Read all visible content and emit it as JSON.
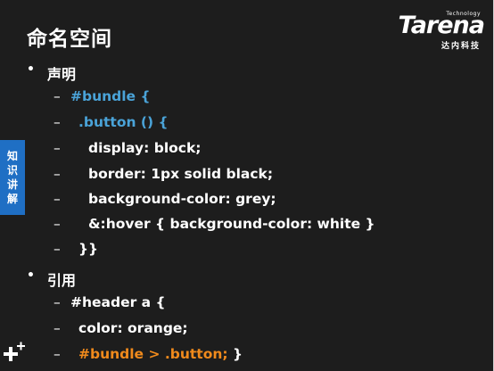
{
  "title": "命名空间",
  "logo": {
    "tech": "Technology",
    "brand": "Tarena",
    "cn": "达内科技"
  },
  "side_tab": [
    "知",
    "识",
    "讲",
    "解"
  ],
  "colors": {
    "background": "#1d1d1d",
    "text": "#ffffff",
    "keyword_blue": "#4aa3d8",
    "highlight_orange": "#f08a1c",
    "tab_blue": "#1f6fc4"
  },
  "bullets": [
    {
      "label": "声明"
    },
    {
      "label": "引用"
    }
  ],
  "lines": [
    {
      "dash": "–",
      "text": "#bundle {",
      "color": "blue"
    },
    {
      "dash": "–",
      "text": ".button () {",
      "color": "blue"
    },
    {
      "dash": "–",
      "text": "display: block;",
      "color": "white"
    },
    {
      "dash": "–",
      "text": "border: 1px solid black;",
      "color": "white"
    },
    {
      "dash": "–",
      "text": "background-color: grey;",
      "color": "white"
    },
    {
      "dash": "–",
      "text": "&:hover { background-color: white }",
      "color": "white"
    },
    {
      "dash": "–",
      "text": "}}",
      "color": "white"
    },
    {
      "dash": "–",
      "text": "#header a {",
      "color": "white"
    },
    {
      "dash": "–",
      "text": "color: orange;",
      "color": "white"
    },
    {
      "dash": "–",
      "text": "#bundle > .button;",
      "trail": " }",
      "color": "orange"
    }
  ],
  "icons": {
    "plus": "plus-sparkle-icon"
  }
}
